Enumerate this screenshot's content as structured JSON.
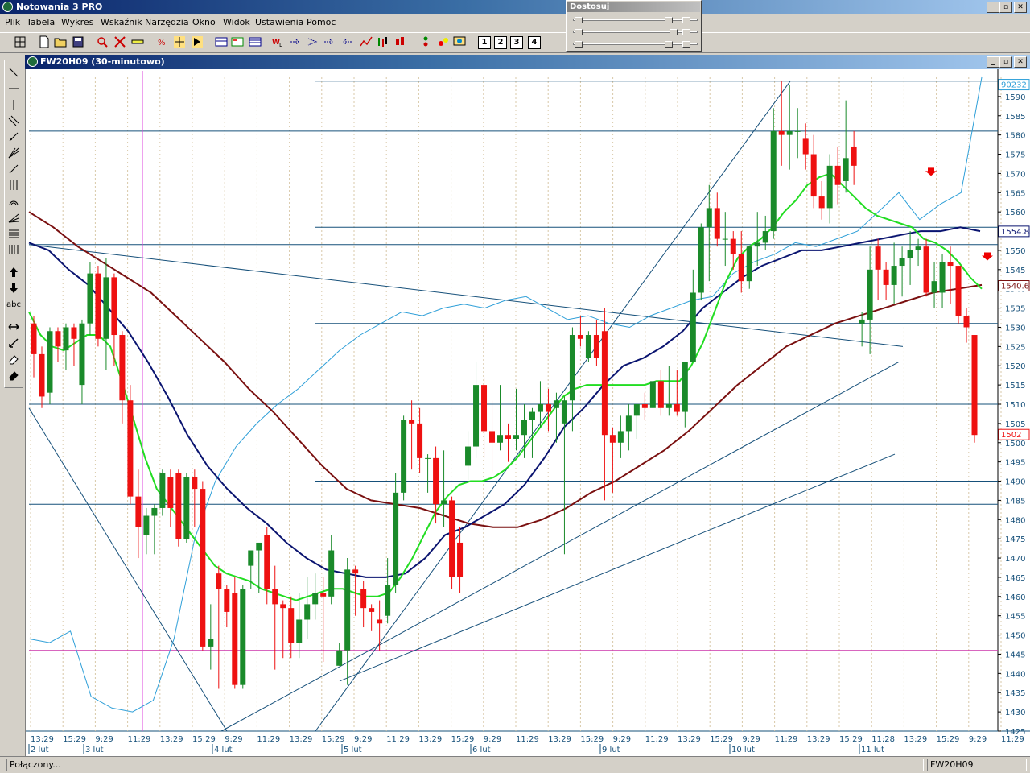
{
  "app": {
    "title": "Notowania 3 PRO",
    "window_buttons": [
      "_",
      "▫",
      "✕"
    ]
  },
  "menu": [
    "Plik",
    "Tabela",
    "Wykres",
    "Wskaźnik",
    "Narzędzia",
    "Okno",
    "Widok",
    "Ustawienia",
    "Pomoc"
  ],
  "toolbar": {
    "icons": [
      "grid-icon",
      "new-icon",
      "open-icon",
      "save-icon",
      "zoom-icon",
      "delete-icon",
      "ruler-icon",
      "percent-icon",
      "cursor-icon",
      "crosshair-icon",
      "table1-icon",
      "table2-icon",
      "table3-icon",
      "wl-icon",
      "arrow1-icon",
      "arrow2-icon",
      "arrow3-icon",
      "arrow4-icon",
      "linechart-icon",
      "barchart-icon",
      "ohlc-icon",
      "candle-icon",
      "dots-icon",
      "dots2-icon",
      "sun-icon",
      "monitor-icon"
    ],
    "numbers": [
      "1",
      "2",
      "3",
      "4"
    ]
  },
  "dostosuj": {
    "title": "Dostosuj"
  },
  "drawing_tools": [
    "line-tool-icon",
    "hline-tool-icon",
    "vline-tool-icon",
    "channel-tool-icon",
    "trend-tool-icon",
    "fan-tool-icon",
    "ray-tool-icon",
    "cycles-tool-icon",
    "arc-tool-icon",
    "gann-tool-icon",
    "fib-tool-icon",
    "fibtime-tool-icon",
    "arrow-up-tool-icon",
    "arrow-down-tool-icon",
    "text-tool-icon",
    "move-tool-icon",
    "select-tool-icon",
    "eraser-tool-icon",
    "eraser-all-tool-icon"
  ],
  "drawing_text_tool": "abc",
  "chart_window": {
    "title": "FW20H09 (30-minutowo)"
  },
  "status": {
    "left": "Połączony...",
    "right": "FW20H09"
  },
  "colors": {
    "bull": "#1a8a2a",
    "bear": "#ee1111",
    "ma_fast": "#22dd22",
    "ma_mid": "#0a1470",
    "ma_slow": "#7a1010",
    "oscillator": "#2e9fd8",
    "hline": "#16507a",
    "trendline": "#16507a",
    "vline": "#dd44dd",
    "hline_magenta": "#cc33aa"
  },
  "chart_data": {
    "type": "candlestick",
    "symbol": "FW20H09",
    "interval": "30-minutowo",
    "ylim": [
      1425,
      1595
    ],
    "y_ticks": [
      1590,
      1585,
      1580,
      1575,
      1570,
      1565,
      1560,
      1555,
      1550,
      1545,
      1540,
      1535,
      1530,
      1525,
      1520,
      1515,
      1510,
      1505,
      1500,
      1495,
      1490,
      1485,
      1480,
      1475,
      1470,
      1465,
      1460,
      1455,
      1450,
      1445,
      1440,
      1435,
      1430,
      1425
    ],
    "x_time_labels": [
      "13:29",
      "15:29",
      "9:29",
      "11:29",
      "13:29",
      "15:29",
      "9:29",
      "11:29",
      "13:29",
      "15:29",
      "9:29",
      "11:29",
      "13:29",
      "15:29",
      "9:29",
      "11:29",
      "13:29",
      "15:29",
      "9:29",
      "11:29",
      "13:29",
      "15:29",
      "9:29",
      "11:29",
      "13:29",
      "15:29",
      "11:28",
      "13:29",
      "15:29",
      "9:29",
      "11:29",
      "13:29",
      "15:29"
    ],
    "x_date_labels": [
      "2 lut",
      "3 lut",
      "4 lut",
      "5 lut",
      "6 lut",
      "9 lut",
      "10 lut",
      "11 lut"
    ],
    "price_labels": [
      {
        "text": "90232",
        "value": 1593,
        "color": "#2e9fd8"
      },
      {
        "text": "1554.83",
        "value": 1554.83,
        "color": "#0a1470"
      },
      {
        "text": "1540.67",
        "value": 1540.67,
        "color": "#7a1010"
      },
      {
        "text": "1502",
        "value": 1502,
        "color": "#ee1111"
      }
    ],
    "candles": [
      {
        "o": 1531,
        "h": 1533,
        "l": 1517,
        "c": 1523
      },
      {
        "o": 1523,
        "h": 1525,
        "l": 1509,
        "c": 1512
      },
      {
        "o": 1513,
        "h": 1530,
        "l": 1510,
        "c": 1529
      },
      {
        "o": 1529,
        "h": 1530,
        "l": 1521,
        "c": 1525
      },
      {
        "o": 1524,
        "h": 1531,
        "l": 1519,
        "c": 1530
      },
      {
        "o": 1530,
        "h": 1531,
        "l": 1520,
        "c": 1527
      },
      {
        "o": 1515,
        "h": 1532,
        "l": 1510,
        "c": 1531
      },
      {
        "o": 1531,
        "h": 1547,
        "l": 1528,
        "c": 1544
      },
      {
        "o": 1544,
        "h": 1546,
        "l": 1525,
        "c": 1527
      },
      {
        "o": 1527,
        "h": 1548,
        "l": 1519,
        "c": 1543
      },
      {
        "o": 1543,
        "h": 1544,
        "l": 1520,
        "c": 1528
      },
      {
        "o": 1528,
        "h": 1529,
        "l": 1505,
        "c": 1511
      },
      {
        "o": 1511,
        "h": 1515,
        "l": 1484,
        "c": 1486
      },
      {
        "o": 1486,
        "h": 1493,
        "l": 1470,
        "c": 1478
      },
      {
        "o": 1476,
        "h": 1483,
        "l": 1471,
        "c": 1481
      },
      {
        "o": 1481,
        "h": 1484,
        "l": 1471,
        "c": 1483
      },
      {
        "o": 1483,
        "h": 1493,
        "l": 1481,
        "c": 1492
      },
      {
        "o": 1491,
        "h": 1493,
        "l": 1478,
        "c": 1483
      },
      {
        "o": 1492,
        "h": 1493,
        "l": 1473,
        "c": 1475
      },
      {
        "o": 1475,
        "h": 1492,
        "l": 1474,
        "c": 1491
      },
      {
        "o": 1491,
        "h": 1493,
        "l": 1478,
        "c": 1488
      },
      {
        "o": 1488,
        "h": 1490,
        "l": 1446,
        "c": 1447
      },
      {
        "o": 1447,
        "h": 1458,
        "l": 1441,
        "c": 1449
      },
      {
        "o": 1466,
        "h": 1468,
        "l": 1436,
        "c": 1462
      },
      {
        "o": 1462,
        "h": 1463,
        "l": 1452,
        "c": 1456
      },
      {
        "o": 1461,
        "h": 1465,
        "l": 1436,
        "c": 1437
      },
      {
        "o": 1437,
        "h": 1463,
        "l": 1436,
        "c": 1462
      },
      {
        "o": 1468,
        "h": 1471,
        "l": 1462,
        "c": 1472
      },
      {
        "o": 1472,
        "h": 1473,
        "l": 1461,
        "c": 1474
      },
      {
        "o": 1476,
        "h": 1478,
        "l": 1458,
        "c": 1462
      },
      {
        "o": 1462,
        "h": 1468,
        "l": 1441,
        "c": 1458
      },
      {
        "o": 1458,
        "h": 1459,
        "l": 1444,
        "c": 1457
      },
      {
        "o": 1457,
        "h": 1460,
        "l": 1444,
        "c": 1448
      },
      {
        "o": 1448,
        "h": 1461,
        "l": 1444,
        "c": 1454
      },
      {
        "o": 1454,
        "h": 1465,
        "l": 1449,
        "c": 1458
      },
      {
        "o": 1458,
        "h": 1466,
        "l": 1454,
        "c": 1461
      },
      {
        "o": 1461,
        "h": 1465,
        "l": 1443,
        "c": 1460
      },
      {
        "o": 1460,
        "h": 1476,
        "l": 1458,
        "c": 1472
      },
      {
        "o": 1442,
        "h": 1448,
        "l": 1442,
        "c": 1446
      },
      {
        "o": 1446,
        "h": 1470,
        "l": 1437,
        "c": 1467
      },
      {
        "o": 1467,
        "h": 1468,
        "l": 1455,
        "c": 1466
      },
      {
        "o": 1462,
        "h": 1464,
        "l": 1452,
        "c": 1457
      },
      {
        "o": 1457,
        "h": 1458,
        "l": 1451,
        "c": 1456
      },
      {
        "o": 1454,
        "h": 1459,
        "l": 1446,
        "c": 1453
      },
      {
        "o": 1455,
        "h": 1470,
        "l": 1453,
        "c": 1463
      },
      {
        "o": 1463,
        "h": 1492,
        "l": 1461,
        "c": 1487
      },
      {
        "o": 1487,
        "h": 1507,
        "l": 1485,
        "c": 1506
      },
      {
        "o": 1506,
        "h": 1511,
        "l": 1493,
        "c": 1505
      },
      {
        "o": 1505,
        "h": 1509,
        "l": 1492,
        "c": 1496
      },
      {
        "o": 1496,
        "h": 1497,
        "l": 1487,
        "c": 1496
      },
      {
        "o": 1496,
        "h": 1499,
        "l": 1479,
        "c": 1484
      },
      {
        "o": 1484,
        "h": 1498,
        "l": 1478,
        "c": 1485
      },
      {
        "o": 1485,
        "h": 1486,
        "l": 1462,
        "c": 1465
      },
      {
        "o": 1474,
        "h": 1478,
        "l": 1461,
        "c": 1465
      },
      {
        "o": 1494,
        "h": 1503,
        "l": 1490,
        "c": 1499
      },
      {
        "o": 1499,
        "h": 1521,
        "l": 1496,
        "c": 1515
      },
      {
        "o": 1515,
        "h": 1517,
        "l": 1496,
        "c": 1503
      },
      {
        "o": 1503,
        "h": 1511,
        "l": 1492,
        "c": 1500
      },
      {
        "o": 1500,
        "h": 1515,
        "l": 1498,
        "c": 1502
      },
      {
        "o": 1502,
        "h": 1505,
        "l": 1495,
        "c": 1501
      },
      {
        "o": 1501,
        "h": 1514,
        "l": 1498,
        "c": 1502
      },
      {
        "o": 1502,
        "h": 1510,
        "l": 1496,
        "c": 1506
      },
      {
        "o": 1506,
        "h": 1509,
        "l": 1496,
        "c": 1508
      },
      {
        "o": 1508,
        "h": 1516,
        "l": 1504,
        "c": 1510
      },
      {
        "o": 1510,
        "h": 1514,
        "l": 1503,
        "c": 1508
      },
      {
        "o": 1509,
        "h": 1513,
        "l": 1500,
        "c": 1511
      },
      {
        "o": 1505,
        "h": 1512,
        "l": 1471,
        "c": 1511
      },
      {
        "o": 1511,
        "h": 1530,
        "l": 1503,
        "c": 1528
      },
      {
        "o": 1528,
        "h": 1533,
        "l": 1525,
        "c": 1527
      },
      {
        "o": 1522,
        "h": 1529,
        "l": 1521,
        "c": 1528
      },
      {
        "o": 1528,
        "h": 1532,
        "l": 1520,
        "c": 1522
      },
      {
        "o": 1529,
        "h": 1535,
        "l": 1485,
        "c": 1502
      },
      {
        "o": 1502,
        "h": 1504,
        "l": 1487,
        "c": 1500
      },
      {
        "o": 1500,
        "h": 1507,
        "l": 1496,
        "c": 1503
      },
      {
        "o": 1503,
        "h": 1510,
        "l": 1498,
        "c": 1507
      },
      {
        "o": 1507,
        "h": 1510,
        "l": 1501,
        "c": 1510
      },
      {
        "o": 1510,
        "h": 1513,
        "l": 1506,
        "c": 1509
      },
      {
        "o": 1509,
        "h": 1514,
        "l": 1509,
        "c": 1516
      },
      {
        "o": 1516,
        "h": 1519,
        "l": 1507,
        "c": 1509
      },
      {
        "o": 1509,
        "h": 1520,
        "l": 1507,
        "c": 1510
      },
      {
        "o": 1510,
        "h": 1519,
        "l": 1507,
        "c": 1508
      },
      {
        "o": 1508,
        "h": 1520,
        "l": 1504,
        "c": 1521
      },
      {
        "o": 1521,
        "h": 1545,
        "l": 1522,
        "c": 1539
      },
      {
        "o": 1539,
        "h": 1557,
        "l": 1537,
        "c": 1556
      },
      {
        "o": 1556,
        "h": 1567,
        "l": 1542,
        "c": 1561
      },
      {
        "o": 1561,
        "h": 1565,
        "l": 1551,
        "c": 1553
      },
      {
        "o": 1553,
        "h": 1560,
        "l": 1546,
        "c": 1553
      },
      {
        "o": 1553,
        "h": 1555,
        "l": 1545,
        "c": 1549
      },
      {
        "o": 1549,
        "h": 1555,
        "l": 1539,
        "c": 1542
      },
      {
        "o": 1542,
        "h": 1551,
        "l": 1540,
        "c": 1551
      },
      {
        "o": 1551,
        "h": 1560,
        "l": 1546,
        "c": 1552
      },
      {
        "o": 1552,
        "h": 1559,
        "l": 1550,
        "c": 1555
      },
      {
        "o": 1555,
        "h": 1587,
        "l": 1553,
        "c": 1581
      },
      {
        "o": 1581,
        "h": 1594,
        "l": 1572,
        "c": 1580
      },
      {
        "o": 1580,
        "h": 1593,
        "l": 1571,
        "c": 1581
      },
      {
        "o": 1581,
        "h": 1587,
        "l": 1574,
        "c": 1581
      },
      {
        "o": 1579,
        "h": 1583,
        "l": 1571,
        "c": 1575
      },
      {
        "o": 1575,
        "h": 1580,
        "l": 1561,
        "c": 1564
      },
      {
        "o": 1564,
        "h": 1568,
        "l": 1558,
        "c": 1561
      },
      {
        "o": 1561,
        "h": 1575,
        "l": 1557,
        "c": 1572
      },
      {
        "o": 1572,
        "h": 1577,
        "l": 1562,
        "c": 1567
      },
      {
        "o": 1568,
        "h": 1589,
        "l": 1565,
        "c": 1574
      },
      {
        "o": 1577,
        "h": 1581,
        "l": 1567,
        "c": 1572
      },
      {
        "o": 1531,
        "h": 1534,
        "l": 1525,
        "c": 1532
      },
      {
        "o": 1532,
        "h": 1551,
        "l": 1523,
        "c": 1545
      },
      {
        "o": 1551,
        "h": 1553,
        "l": 1537,
        "c": 1545
      },
      {
        "o": 1545,
        "h": 1547,
        "l": 1537,
        "c": 1541
      },
      {
        "o": 1541,
        "h": 1552,
        "l": 1536,
        "c": 1546
      },
      {
        "o": 1546,
        "h": 1551,
        "l": 1538,
        "c": 1548
      },
      {
        "o": 1548,
        "h": 1555,
        "l": 1541,
        "c": 1550
      },
      {
        "o": 1550,
        "h": 1553,
        "l": 1546,
        "c": 1551
      },
      {
        "o": 1551,
        "h": 1553,
        "l": 1538,
        "c": 1539
      },
      {
        "o": 1539,
        "h": 1547,
        "l": 1535,
        "c": 1542
      },
      {
        "o": 1539,
        "h": 1549,
        "l": 1535,
        "c": 1547
      },
      {
        "o": 1547,
        "h": 1551,
        "l": 1536,
        "c": 1546
      },
      {
        "o": 1546,
        "h": 1546,
        "l": 1531,
        "c": 1533
      },
      {
        "o": 1533,
        "h": 1535,
        "l": 1526,
        "c": 1530
      },
      {
        "o": 1528,
        "h": 1528,
        "l": 1500,
        "c": 1502
      }
    ],
    "ma_fast": [
      1534,
      1528,
      1525,
      1524,
      1526,
      1528,
      1528,
      1525,
      1516,
      1506,
      1496,
      1488,
      1484,
      1480,
      1476,
      1472,
      1468,
      1466,
      1465,
      1464,
      1462,
      1461,
      1460,
      1459,
      1460,
      1461,
      1462,
      1462,
      1461,
      1460,
      1460,
      1461,
      1465,
      1470,
      1476,
      1482,
      1486,
      1489,
      1490,
      1490,
      1491,
      1493,
      1496,
      1500,
      1504,
      1508,
      1512,
      1514,
      1515,
      1515,
      1515,
      1515,
      1515,
      1515,
      1516,
      1516,
      1516,
      1520,
      1526,
      1534,
      1542,
      1548,
      1551,
      1553,
      1556,
      1560,
      1563,
      1567,
      1569,
      1570,
      1567,
      1564,
      1561,
      1559,
      1558,
      1557,
      1556,
      1553,
      1552,
      1550,
      1547,
      1543,
      1540
    ],
    "ma_mid": [
      1552,
      1550,
      1545,
      1541,
      1535,
      1529,
      1521,
      1512,
      1502,
      1494,
      1488,
      1483,
      1479,
      1474,
      1470,
      1467,
      1466,
      1465,
      1465,
      1466,
      1470,
      1476,
      1478,
      1481,
      1484,
      1489,
      1496,
      1504,
      1509,
      1515,
      1520,
      1522,
      1525,
      1529,
      1535,
      1539,
      1543,
      1546,
      1548,
      1550,
      1550,
      1551,
      1552,
      1553,
      1554,
      1555,
      1555,
      1556,
      1555
    ],
    "ma_slow": [
      1560,
      1556,
      1551,
      1547,
      1543,
      1539,
      1533,
      1527,
      1521,
      1514,
      1508,
      1501,
      1494,
      1488,
      1485,
      1484,
      1483,
      1481,
      1479,
      1478,
      1478,
      1480,
      1483,
      1487,
      1490,
      1494,
      1498,
      1503,
      1509,
      1515,
      1520,
      1525,
      1528,
      1531,
      1533,
      1535,
      1537,
      1539,
      1540,
      1541
    ],
    "oscillator": [
      1449,
      1448,
      1451,
      1434,
      1431,
      1430,
      1433,
      1449,
      1475,
      1490,
      1499,
      1505,
      1510,
      1514,
      1519,
      1524,
      1528,
      1531,
      1534,
      1533,
      1535,
      1536,
      1535,
      1537,
      1538,
      1535,
      1532,
      1533,
      1531,
      1530,
      1533,
      1535,
      1537,
      1538,
      1544,
      1547,
      1549,
      1552,
      1551,
      1553,
      1555,
      1560,
      1565,
      1558,
      1562,
      1565,
      1595
    ]
  }
}
